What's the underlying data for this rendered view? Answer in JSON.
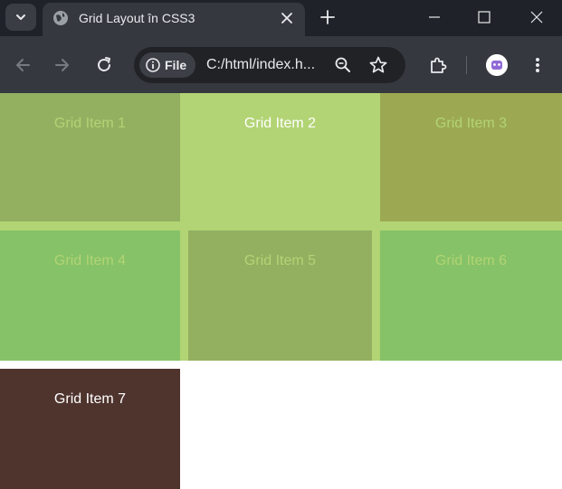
{
  "browser": {
    "tab_title": "Grid Layout în CSS3",
    "address": {
      "chip_label": "File",
      "url": "C:/html/index.h..."
    },
    "icons": {
      "tab_search": "chevron-down-icon",
      "favicon": "globe-icon",
      "tab_close": "close-icon",
      "new_tab": "plus-icon",
      "back": "arrow-left-icon",
      "forward": "arrow-right-icon",
      "reload": "reload-icon",
      "site_info": "info-icon",
      "zoom": "zoom-out-icon",
      "bookmark": "star-icon",
      "extensions": "puzzle-icon",
      "menu": "kebab-menu-icon"
    }
  },
  "page": {
    "grid_items": [
      {
        "label": "Grid Item 1"
      },
      {
        "label": "Grid Item 2"
      },
      {
        "label": "Grid Item 3"
      },
      {
        "label": "Grid Item 4"
      },
      {
        "label": "Grid Item 5"
      },
      {
        "label": "Grid Item 6"
      },
      {
        "label": "Grid Item 7"
      }
    ]
  },
  "colors": {
    "chrome_tabstrip": "#1f2228",
    "chrome_toolbar": "#35383f",
    "grid_background": "#b2d474",
    "item_dark_brown": "#4f342e"
  }
}
